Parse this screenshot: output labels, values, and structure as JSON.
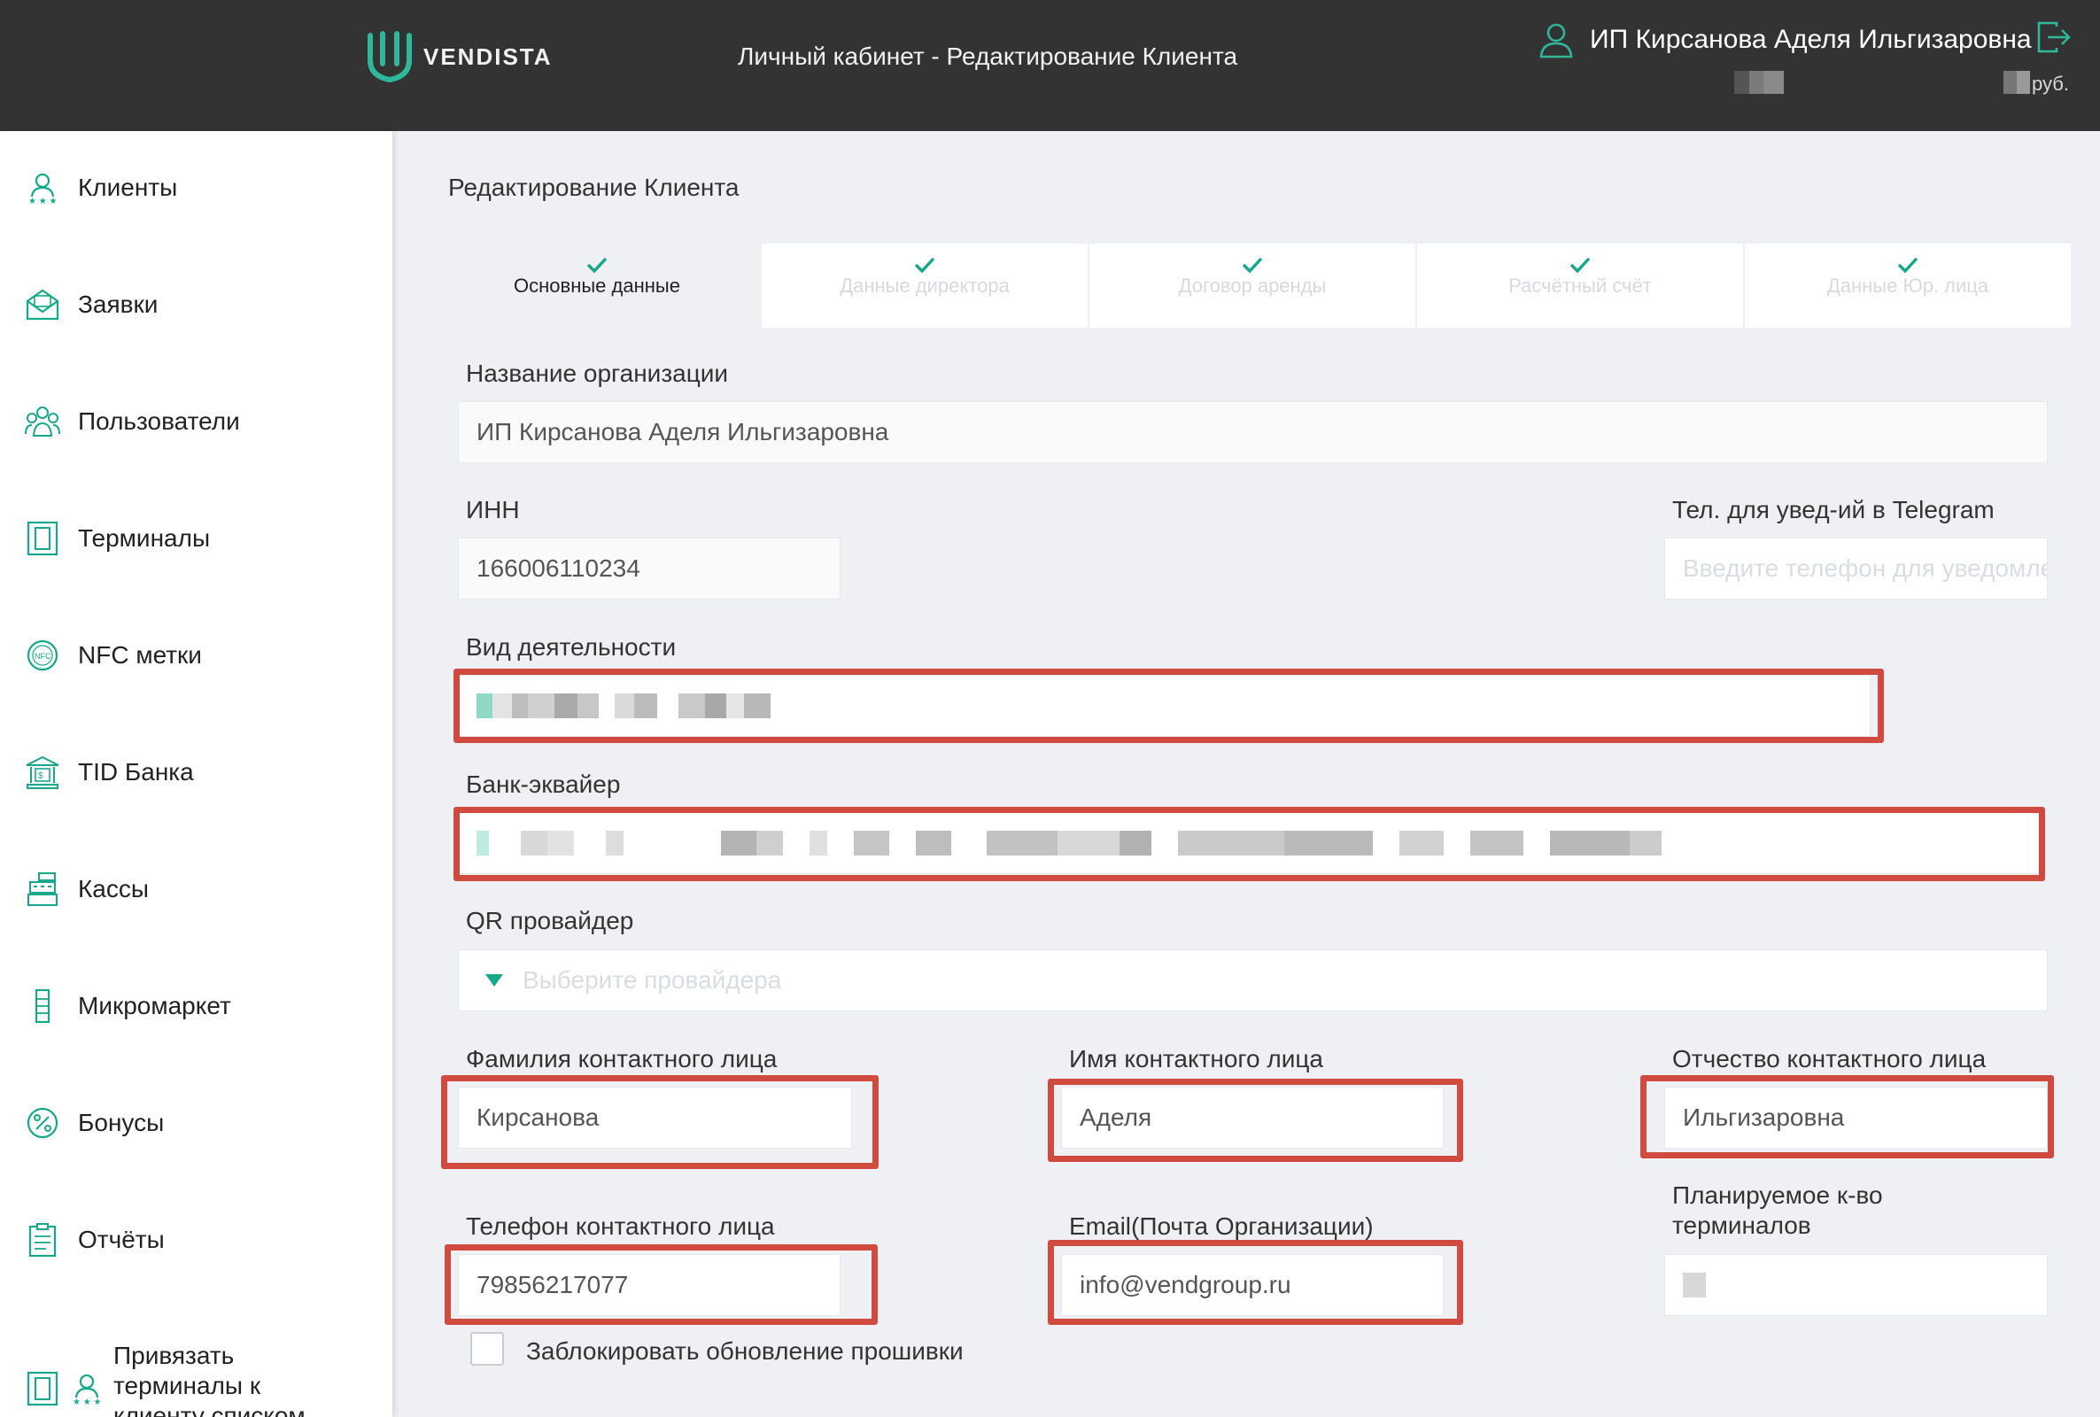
{
  "header": {
    "logo_text": "VENDISTA",
    "title": "Личный кабинет - Редактирование Клиента",
    "user_name": "ИП Кирсанова Аделя Ильгизаровна",
    "currency": "руб."
  },
  "sidebar": {
    "items": [
      {
        "label": "Клиенты",
        "icon": "clients-icon"
      },
      {
        "label": "Заявки",
        "icon": "requests-icon"
      },
      {
        "label": "Пользователи",
        "icon": "users-icon"
      },
      {
        "label": "Терминалы",
        "icon": "terminal-icon"
      },
      {
        "label": "NFC метки",
        "icon": "nfc-icon"
      },
      {
        "label": "TID Банка",
        "icon": "bank-icon"
      },
      {
        "label": "Кассы",
        "icon": "cash-register-icon"
      },
      {
        "label": "Микромаркет",
        "icon": "micromarket-icon"
      },
      {
        "label": "Бонусы",
        "icon": "bonus-icon"
      },
      {
        "label": "Отчёты",
        "icon": "reports-icon"
      },
      {
        "label": "Привязать терминалы к клиенту списком",
        "icon": "bind-terminals-icon"
      }
    ]
  },
  "page_title": "Редактирование Клиента",
  "tabs": [
    {
      "label": "Основные данные",
      "active": true
    },
    {
      "label": "Данные директора",
      "active": false
    },
    {
      "label": "Договор аренды",
      "active": false
    },
    {
      "label": "Расчётный счёт",
      "active": false
    },
    {
      "label": "Данные Юр. лица",
      "active": false
    }
  ],
  "form": {
    "org_name_label": "Название организации",
    "org_name_value": "ИП Кирсанова Аделя Ильгизаровна",
    "inn_label": "ИНН",
    "inn_value": "166006110234",
    "telegram_label": "Тел. для увед-ий в Telegram",
    "telegram_placeholder": "Введите телефон для уведомлений",
    "activity_label": "Вид деятельности",
    "bank_label": "Банк-эквайер",
    "qr_label": "QR провайдер",
    "qr_placeholder": "Выберите провайдера",
    "last_name_label": "Фамилия контактного лица",
    "last_name_value": "Кирсанова",
    "first_name_label": "Имя контактного лица",
    "first_name_value": "Аделя",
    "middle_name_label": "Отчество контактного лица",
    "middle_name_value": "Ильгизаровна",
    "phone_label": "Телефон контактного лица",
    "phone_value": "79856217077",
    "email_label": "Email(Почта Организации)",
    "email_value": "info@vendgroup.ru",
    "planned_label": "Планируемое к-во терминалов",
    "block_firmware_label": "Заблокировать обновление прошивки"
  },
  "colors": {
    "header_bg": "#333333",
    "accent": "#16a88a",
    "highlight": "#d14a40"
  }
}
